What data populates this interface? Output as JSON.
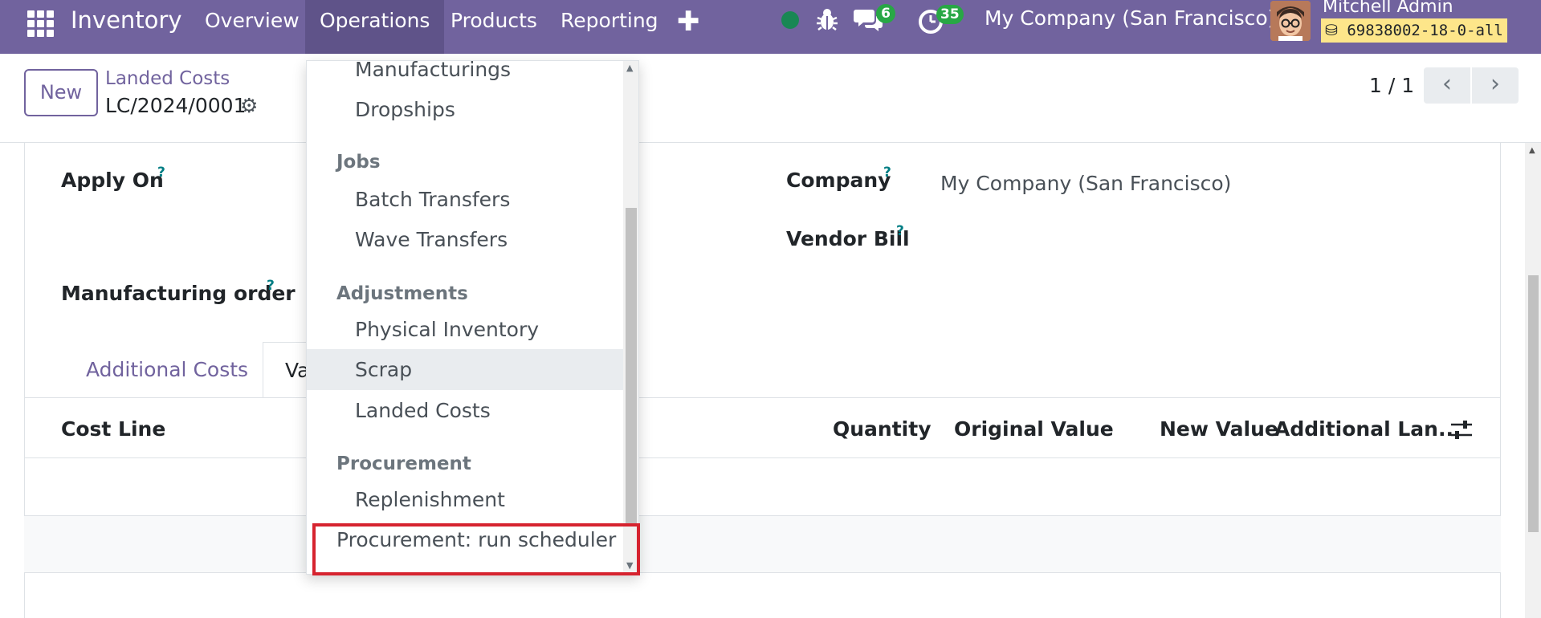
{
  "navbar": {
    "brand": "Inventory",
    "menu": [
      "Overview",
      "Operations",
      "Products",
      "Reporting"
    ],
    "active_menu": "Operations",
    "messages_count": "6",
    "activities_count": "35",
    "company": "My Company (San Francisco)",
    "user_name": "Mitchell Admin",
    "database": "69838002-18-0-all",
    "status_color": "#198754"
  },
  "control_panel": {
    "new_button": "New",
    "breadcrumb": "Landed Costs",
    "record_name": "LC/2024/0001",
    "pager": "1 / 1",
    "prev_symbol": "‹",
    "next_symbol": "›"
  },
  "form": {
    "apply_on_label": "Apply On",
    "company_label": "Company",
    "company_value": "My Company (San Francisco)",
    "vendor_bill_label": "Vendor Bill",
    "manufacturing_order_label": "Manufacturing order",
    "help_mark": "?"
  },
  "tabs": {
    "additional_costs": "Additional Costs",
    "valuation_partial": "Va"
  },
  "table": {
    "columns": [
      "Cost Line",
      "Quantity",
      "Original Value",
      "New Value",
      "Additional Lan..."
    ]
  },
  "dropdown": {
    "items": [
      {
        "type": "item",
        "label": "Manufacturings"
      },
      {
        "type": "item",
        "label": "Dropships"
      },
      {
        "type": "header",
        "label": "Jobs"
      },
      {
        "type": "item",
        "label": "Batch Transfers"
      },
      {
        "type": "item",
        "label": "Wave Transfers"
      },
      {
        "type": "header",
        "label": "Adjustments"
      },
      {
        "type": "item",
        "label": "Physical Inventory"
      },
      {
        "type": "item",
        "label": "Scrap"
      },
      {
        "type": "item",
        "label": "Landed Costs"
      },
      {
        "type": "header",
        "label": "Procurement"
      },
      {
        "type": "item",
        "label": "Replenishment"
      },
      {
        "type": "top-item",
        "label": "Procurement: run scheduler"
      }
    ],
    "hovered": "Scrap",
    "highlighted": "Procurement: run scheduler",
    "highlight_color": "#d6232f"
  },
  "colors": {
    "brand": "#71639e",
    "brand_dark": "#5f5389",
    "badge": "#28a745"
  }
}
